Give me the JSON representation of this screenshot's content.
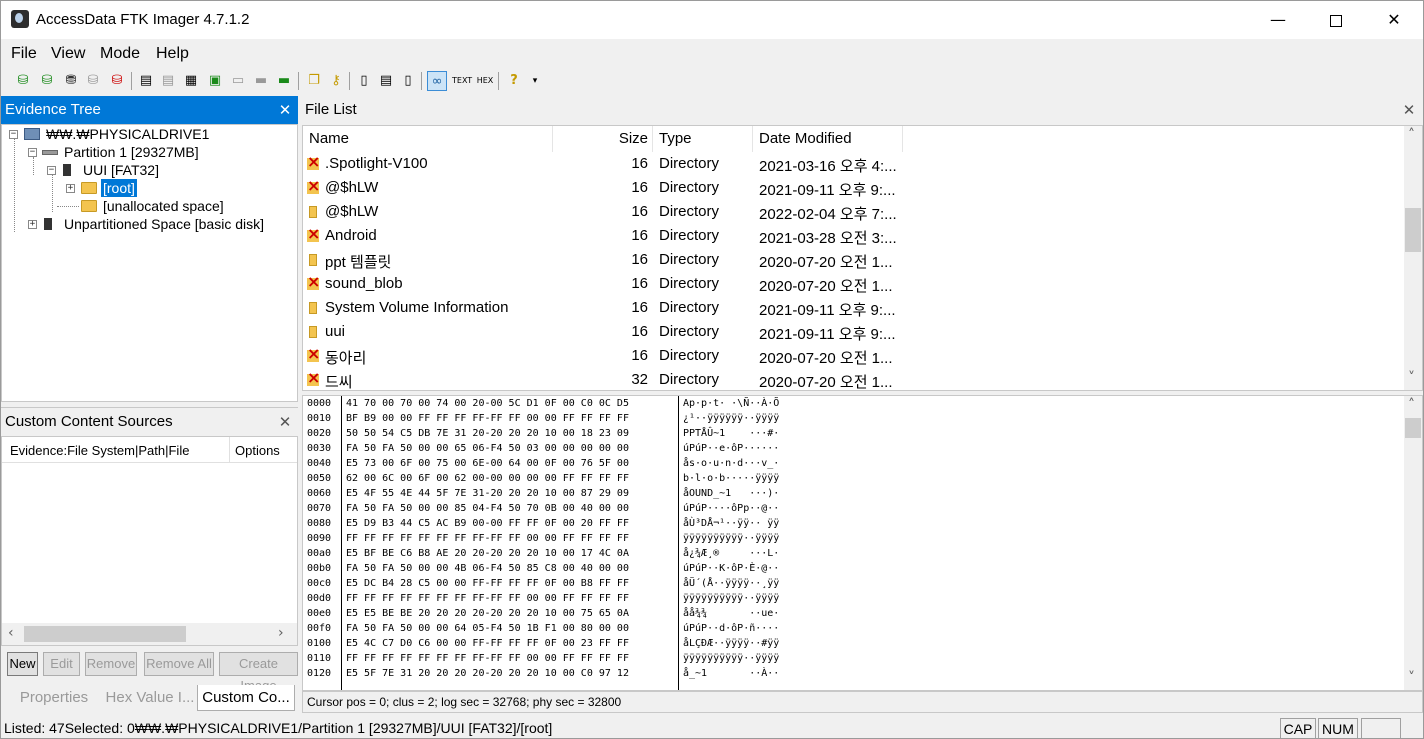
{
  "window": {
    "title": "AccessData FTK Imager 4.7.1.2",
    "minimize": "—",
    "close": "✕"
  },
  "menu": [
    "File",
    "View",
    "Mode",
    "Help"
  ],
  "panels": {
    "evidence_tree": "Evidence Tree",
    "file_list": "File List",
    "custom_content": "Custom Content Sources",
    "close_glyph": "✕"
  },
  "evidence_tree": {
    "nodes": [
      {
        "label": "₩₩.₩PHYSICALDRIVE1",
        "icon": "physical-drive-icon"
      },
      {
        "label": "Partition 1 [29327MB]",
        "icon": "partition-icon"
      },
      {
        "label": "UUI [FAT32]",
        "icon": "filesystem-icon"
      },
      {
        "label": "[root]",
        "icon": "folder-icon",
        "selected": true
      },
      {
        "label": "[unallocated space]",
        "icon": "folder-icon"
      },
      {
        "label": "Unpartitioned Space [basic disk]",
        "icon": "filesystem-icon"
      }
    ]
  },
  "custom_content": {
    "columns": [
      "Evidence:File System|Path|File",
      "Options"
    ],
    "buttons": {
      "new": "New",
      "edit": "Edit",
      "remove": "Remove",
      "remove_all": "Remove All",
      "create_image": "Create Image"
    }
  },
  "bottom_tabs": [
    "Properties",
    "Hex Value I...",
    "Custom Co..."
  ],
  "file_list": {
    "columns": [
      "Name",
      "Size",
      "Type",
      "Date Modified"
    ],
    "rows": [
      {
        "name": ".Spotlight-V100",
        "size": "16",
        "type": "Directory",
        "date": "2021-03-16 오후 4:...",
        "deleted": true
      },
      {
        "name": "@$hLW",
        "size": "16",
        "type": "Directory",
        "date": "2021-09-11 오후 9:...",
        "deleted": true
      },
      {
        "name": "@$hLW",
        "size": "16",
        "type": "Directory",
        "date": "2022-02-04 오후 7:...",
        "deleted": false
      },
      {
        "name": "Android",
        "size": "16",
        "type": "Directory",
        "date": "2021-03-28 오전 3:...",
        "deleted": true
      },
      {
        "name": "ppt 템플릿",
        "size": "16",
        "type": "Directory",
        "date": "2020-07-20 오전 1...",
        "deleted": false
      },
      {
        "name": "sound_blob",
        "size": "16",
        "type": "Directory",
        "date": "2020-07-20 오전 1...",
        "deleted": true
      },
      {
        "name": "System Volume Information",
        "size": "16",
        "type": "Directory",
        "date": "2021-09-11 오후 9:...",
        "deleted": false
      },
      {
        "name": "uui",
        "size": "16",
        "type": "Directory",
        "date": "2021-09-11 오후 9:...",
        "deleted": false
      },
      {
        "name": "동아리",
        "size": "16",
        "type": "Directory",
        "date": "2020-07-20 오전 1...",
        "deleted": true
      },
      {
        "name": "드씨",
        "size": "32",
        "type": "Directory",
        "date": "2020-07-20 오전 1...",
        "deleted": true
      }
    ]
  },
  "hex_view": {
    "rows": [
      {
        "offset": "0000",
        "bytes": "41 70 00 70 00 74 00 20-00 5C D1 0F 00 C0 0C D5",
        "ascii": "Ap·p·t· ·\\Ñ··À·Õ"
      },
      {
        "offset": "0010",
        "bytes": "BF B9 00 00 FF FF FF FF-FF FF 00 00 FF FF FF FF",
        "ascii": "¿¹··ÿÿÿÿÿÿ··ÿÿÿÿ"
      },
      {
        "offset": "0020",
        "bytes": "50 50 54 C5 DB 7E 31 20-20 20 20 10 00 18 23 09",
        "ascii": "PPTÅÛ~1    ···#·"
      },
      {
        "offset": "0030",
        "bytes": "FA 50 FA 50 00 00 65 06-F4 50 03 00 00 00 00 00",
        "ascii": "úPúP··e·ôP······"
      },
      {
        "offset": "0040",
        "bytes": "E5 73 00 6F 00 75 00 6E-00 64 00 0F 00 76 5F 00",
        "ascii": "ås·o·u·n·d···v_·"
      },
      {
        "offset": "0050",
        "bytes": "62 00 6C 00 6F 00 62 00-00 00 00 00 FF FF FF FF",
        "ascii": "b·l·o·b·····ÿÿÿÿ"
      },
      {
        "offset": "0060",
        "bytes": "E5 4F 55 4E 44 5F 7E 31-20 20 20 10 00 87 29 09",
        "ascii": "åOUND_~1   ···)·"
      },
      {
        "offset": "0070",
        "bytes": "FA 50 FA 50 00 00 85 04-F4 50 70 0B 00 40 00 00",
        "ascii": "úPúP····ôPp··@··"
      },
      {
        "offset": "0080",
        "bytes": "E5 D9 B3 44 C5 AC B9 00-00 FF FF 0F 00 20 FF FF",
        "ascii": "åÙ³DÅ¬¹··ÿÿ·· ÿÿ"
      },
      {
        "offset": "0090",
        "bytes": "FF FF FF FF FF FF FF FF-FF FF 00 00 FF FF FF FF",
        "ascii": "ÿÿÿÿÿÿÿÿÿÿ··ÿÿÿÿ"
      },
      {
        "offset": "00a0",
        "bytes": "E5 BF BE C6 B8 AE 20 20-20 20 20 10 00 17 4C 0A",
        "ascii": "å¿¾Æ¸®     ···L·"
      },
      {
        "offset": "00b0",
        "bytes": "FA 50 FA 50 00 00 4B 06-F4 50 85 C8 00 40 00 00",
        "ascii": "úPúP··K·ôP·È·@··"
      },
      {
        "offset": "00c0",
        "bytes": "E5 DC B4 28 C5 00 00 FF-FF FF FF 0F 00 B8 FF FF",
        "ascii": "åÜ´(Å··ÿÿÿÿ··¸ÿÿ"
      },
      {
        "offset": "00d0",
        "bytes": "FF FF FF FF FF FF FF FF-FF FF 00 00 FF FF FF FF",
        "ascii": "ÿÿÿÿÿÿÿÿÿÿ··ÿÿÿÿ"
      },
      {
        "offset": "00e0",
        "bytes": "E5 E5 BE BE 20 20 20 20-20 20 20 10 00 75 65 0A",
        "ascii": "åå¾¾       ··ue·"
      },
      {
        "offset": "00f0",
        "bytes": "FA 50 FA 50 00 00 64 05-F4 50 1B F1 00 80 00 00",
        "ascii": "úPúP··d·ôP·ñ····"
      },
      {
        "offset": "0100",
        "bytes": "E5 4C C7 D0 C6 00 00 FF-FF FF FF 0F 00 23 FF FF",
        "ascii": "åLÇÐÆ··ÿÿÿÿ··#ÿÿ"
      },
      {
        "offset": "0110",
        "bytes": "FF FF FF FF FF FF FF FF-FF FF 00 00 FF FF FF FF",
        "ascii": "ÿÿÿÿÿÿÿÿÿÿ··ÿÿÿÿ"
      },
      {
        "offset": "0120",
        "bytes": "E5 5F 7E 31 20 20 20 20-20 20 20 10 00 C0 97 12",
        "ascii": "å_~1       ··À··"
      }
    ],
    "cursor_status": "Cursor pos = 0; clus = 2; log sec = 32768; phy sec = 32800"
  },
  "status": {
    "text": "Listed: 47Selected: 0₩₩.₩PHYSICALDRIVE1/Partition 1 [29327MB]/UUI [FAT32]/[root]",
    "cap": "CAP",
    "num": "NUM"
  },
  "colors": {
    "selection": "#0078d7",
    "deleted_marker": "#cc0000",
    "folder": "#f3c44f"
  }
}
